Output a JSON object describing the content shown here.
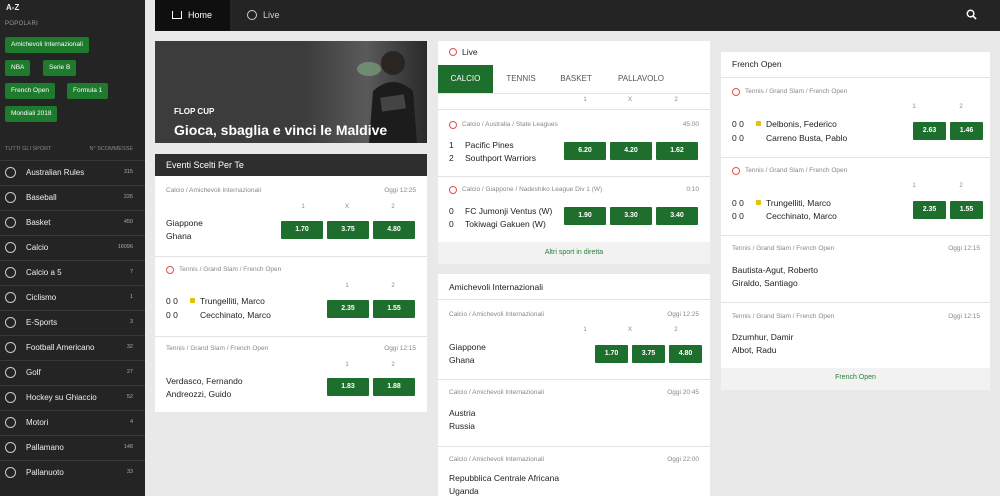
{
  "sidebar": {
    "az": "A-Z",
    "popular_label": "POPOLARI",
    "popular": [
      "Amichevoli Internazionali",
      "NBA",
      "Serie B",
      "French Open",
      "Formula 1",
      "Mondiali 2018"
    ],
    "all_sports_label": "TUTTI GLI SPORT",
    "count_label": "N° SCOMMESSE",
    "sports": [
      {
        "name": "Australian Rules",
        "count": "315",
        "icon": "ball-icon"
      },
      {
        "name": "Baseball",
        "count": "226",
        "icon": "baseball-icon"
      },
      {
        "name": "Basket",
        "count": "450",
        "icon": "basketball-icon"
      },
      {
        "name": "Calcio",
        "count": "16096",
        "icon": "soccer-icon"
      },
      {
        "name": "Calcio a 5",
        "count": "7",
        "icon": "soccer-icon"
      },
      {
        "name": "Ciclismo",
        "count": "1",
        "icon": "bicycle-icon"
      },
      {
        "name": "E-Sports",
        "count": "3",
        "icon": "gamepad-icon"
      },
      {
        "name": "Football Americano",
        "count": "32",
        "icon": "football-icon"
      },
      {
        "name": "Golf",
        "count": "27",
        "icon": "golf-icon"
      },
      {
        "name": "Hockey su Ghiaccio",
        "count": "52",
        "icon": "hockey-icon"
      },
      {
        "name": "Motori",
        "count": "4",
        "icon": "motor-icon"
      },
      {
        "name": "Pallamano",
        "count": "148",
        "icon": "handball-icon"
      },
      {
        "name": "Pallanuoto",
        "count": "33",
        "icon": "waterpolo-icon"
      }
    ]
  },
  "nav": {
    "home": "Home",
    "live": "Live"
  },
  "banner": {
    "title": "FLOP CUP",
    "subtitle": "Gioca, sbaglia e vinci le Maldive"
  },
  "featured": {
    "title": "Eventi Scelti Per Te",
    "m1": {
      "meta": "Calcio / Amichevoli Internazionali",
      "time": "Oggi 12:25",
      "h1": "1",
      "hx": "X",
      "h2": "2",
      "t1": "Giappone",
      "t2": "Ghana",
      "o1": "1.70",
      "ox": "3.75",
      "o2": "4.80"
    },
    "m2": {
      "meta": "Tennis / Grand Slam / French Open",
      "h1": "1",
      "h2": "2",
      "s1": "0  0",
      "s2": "0  0",
      "t1": "Trungelliti, Marco",
      "t2": "Cecchinato, Marco",
      "o1": "2.35",
      "o2": "1.55"
    },
    "m3": {
      "meta": "Tennis / Grand Slam / French Open",
      "time": "Oggi 12:15",
      "h1": "1",
      "h2": "2",
      "t1": "Verdasco, Fernando",
      "t2": "Andreozzi, Guido",
      "o1": "1.83",
      "o2": "1.88"
    }
  },
  "live": {
    "title": "Live",
    "tabs": [
      "CALCIO",
      "TENNIS",
      "BASKET",
      "PALLAVOLO"
    ],
    "h1": "1",
    "hx": "X",
    "h2": "2",
    "m1": {
      "meta": "Calcio / Australia / State Leagues",
      "time": "45:00",
      "s1": "1",
      "s2": "2",
      "t1": "Pacific Pines",
      "t2": "Southport Warriors",
      "o1": "6.20",
      "ox": "4.20",
      "o2": "1.62"
    },
    "m2": {
      "meta": "Calcio / Giappone / Nadeshiko League Div 1 (W)",
      "time": "0:10",
      "s1": "0",
      "s2": "0",
      "t1": "FC Jumonji Ventus (W)",
      "t2": "Tokiwagi Gakuen (W)",
      "o1": "1.90",
      "ox": "3.30",
      "o2": "3.40"
    },
    "more": "Altri sport in diretta"
  },
  "amichevoli": {
    "title": "Amichevoli Internazionali",
    "m1": {
      "meta": "Calcio / Amichevoli Internazionali",
      "time": "Oggi 12:25",
      "h1": "1",
      "hx": "X",
      "h2": "2",
      "t1": "Giappone",
      "t2": "Ghana",
      "o1": "1.70",
      "ox": "3.75",
      "o2": "4.80"
    },
    "m2": {
      "meta": "Calcio / Amichevoli Internazionali",
      "time": "Oggi 20:45",
      "t1": "Austria",
      "t2": "Russia"
    },
    "m3": {
      "meta": "Calcio / Amichevoli Internazionali",
      "time": "Oggi 22:00",
      "t1": "Repubblica Centrale Africana",
      "t2": "Uganda"
    }
  },
  "french": {
    "title": "French Open",
    "m1": {
      "meta": "Tennis / Grand Slam / French Open",
      "h1": "1",
      "h2": "2",
      "s1": "0  0",
      "s2": "0  0",
      "t1": "Delbonis, Federico",
      "t2": "Carreno Busta, Pablo",
      "o1": "2.63",
      "o2": "1.46"
    },
    "m2": {
      "meta": "Tennis / Grand Slam / French Open",
      "h1": "1",
      "h2": "2",
      "s1": "0  0",
      "s2": "0  0",
      "t1": "Trungelliti, Marco",
      "t2": "Cecchinato, Marco",
      "o1": "2.35",
      "o2": "1.55"
    },
    "m3": {
      "meta": "Tennis / Grand Slam / French Open",
      "time": "Oggi 12:15",
      "t1": "Bautista-Agut, Roberto",
      "t2": "Giraldo, Santiago"
    },
    "m4": {
      "meta": "Tennis / Grand Slam / French Open",
      "time": "Oggi 12:15",
      "t1": "Dzumhur, Damir",
      "t2": "Albot, Radu"
    },
    "more": "French Open"
  },
  "colors": {
    "green": "#1e6e2d",
    "dark": "#242424",
    "accent_tennis": "#d9534f"
  }
}
